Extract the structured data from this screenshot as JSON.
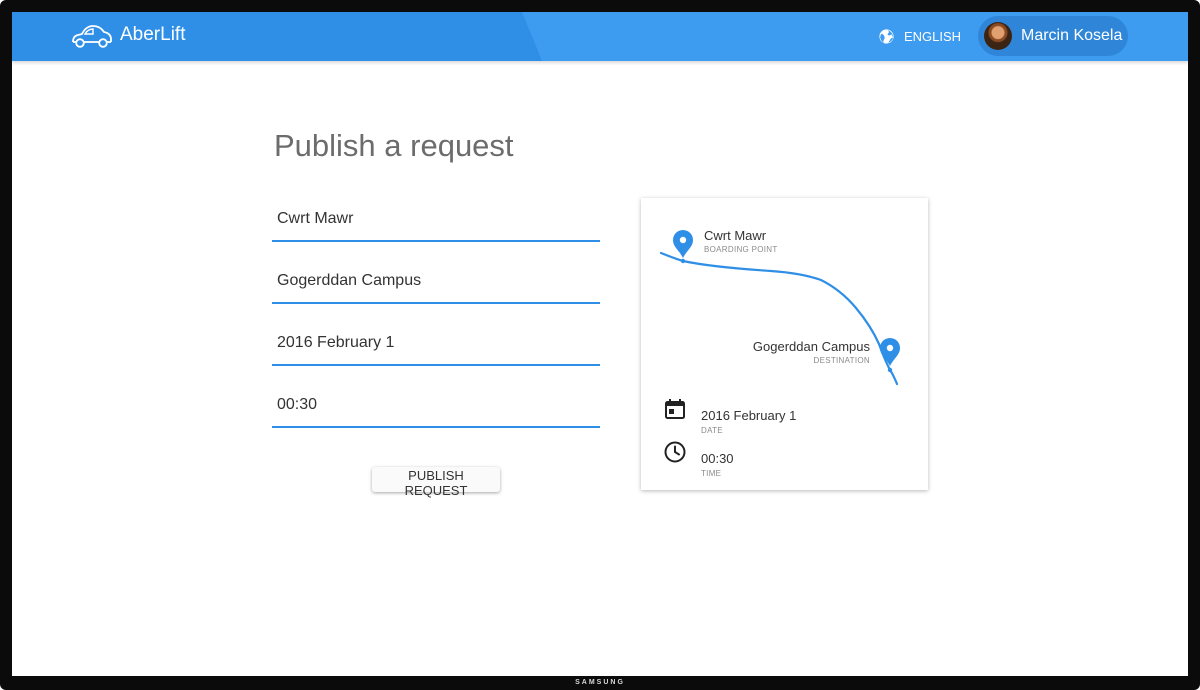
{
  "header": {
    "app_name": "AberLift",
    "language_label": "ENGLISH",
    "user_name": "Marcin Kosela",
    "logo_icon": "car-outline-icon",
    "language_icon": "globe-icon",
    "accent_color": "#3d9bf0"
  },
  "device": {
    "brand": "SAMSUNG"
  },
  "form": {
    "title": "Publish a request",
    "from_value": "Cwrt Mawr",
    "to_value": "Gogerddan Campus",
    "date_value": "2016 February 1",
    "time_value": "00:30",
    "submit_label": "PUBLISH REQUEST"
  },
  "summary": {
    "boarding": {
      "name": "Cwrt Mawr",
      "label": "BOARDING POINT",
      "icon": "map-pin-icon"
    },
    "destination": {
      "name": "Gogerddan Campus",
      "label": "DESTINATION",
      "icon": "map-pin-icon"
    },
    "date": {
      "value": "2016 February 1",
      "label": "DATE",
      "icon": "calendar-icon"
    },
    "time": {
      "value": "00:30",
      "label": "TIME",
      "icon": "clock-icon"
    }
  }
}
